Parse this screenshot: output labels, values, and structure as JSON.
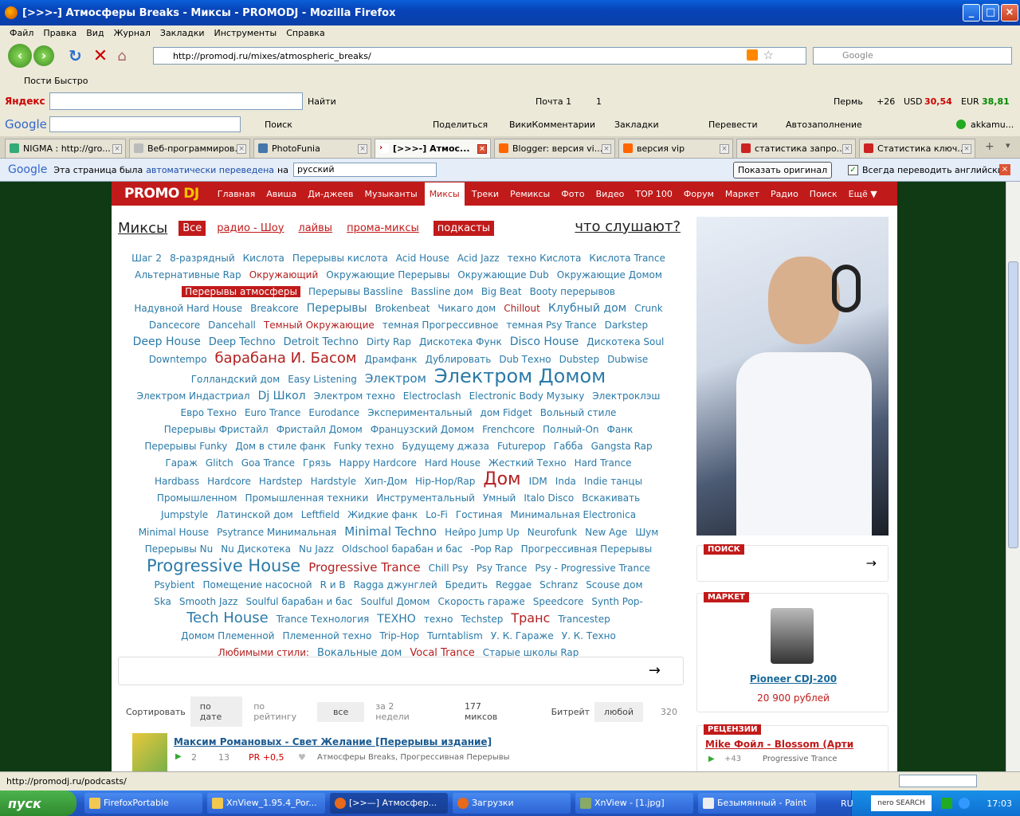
{
  "window": {
    "title": "[>>>-] Атмосферы Breaks - Миксы - PROMODJ - Mozilla Firefox"
  },
  "menu": [
    "Файл",
    "Правка",
    "Вид",
    "Журнал",
    "Закладки",
    "Инструменты",
    "Справка"
  ],
  "nav": {
    "url": "http://promodj.ru/mixes/atmospheric_breaks/",
    "search_placeholder": "Google"
  },
  "bookmarks": {
    "item": "Пости Быстро"
  },
  "yandex": {
    "logo": "Яндекс",
    "find": "Найти",
    "mail": "Почта 1",
    "counter": "1",
    "city": "Пермь",
    "temp": "+26",
    "usd_label": "USD",
    "usd": "30,54",
    "eur_label": "EUR",
    "eur": "38,81"
  },
  "google_toolbar": {
    "logo": "Google",
    "search": "Поиск",
    "share": "Поделиться",
    "wiki": "ВикиКомментарии",
    "bookmarks": "Закладки",
    "translate": "Перевести",
    "autofill": "Автозаполнение",
    "user": "akkamu..."
  },
  "tabs": [
    {
      "label": "NIGMA : http://gro...",
      "color": "#3a7"
    },
    {
      "label": "Веб-программиров...",
      "color": "#999"
    },
    {
      "label": "PhotoFunia",
      "color": "#47a"
    },
    {
      "label": "[>>>-] Атмос...",
      "color": "#d53"
    },
    {
      "label": "Blogger: версия vi...",
      "color": "#f60"
    },
    {
      "label": "версия vip",
      "color": "#f60"
    },
    {
      "label": "статистика запро...",
      "color": "#c22"
    },
    {
      "label": "Статистика ключ...",
      "color": "#c22"
    }
  ],
  "translate_bar": {
    "logo": "Google",
    "text1": "Эта страница была",
    "link": "автоматически переведена",
    "text2": "на",
    "lang": "русский",
    "show_original": "Показать оригинал",
    "always": "Всегда переводить английский"
  },
  "site": {
    "logo1": "PROMO",
    "logo2": "DJ",
    "nav": [
      "Главная",
      "Авиша",
      "Ди-джеев",
      "Музыканты",
      "Миксы",
      "Треки",
      "Ремиксы",
      "Фото",
      "Видео",
      "TOP 100",
      "Форум",
      "Маркет",
      "Радио",
      "Поиск",
      "Ещё ▼"
    ],
    "mixes_title": "Миксы",
    "filters": {
      "all": "Все",
      "radio": "радио - Шоу",
      "lives": "лайвы",
      "promo": "прома-миксы",
      "podcasts": "подкасты"
    },
    "what_listen": "что слушают?",
    "sort": {
      "label": "Сортировать",
      "by_date": "по дате",
      "by_rating": "по рейтингу",
      "all": "все",
      "period": "за 2 недели",
      "count": "177 миксов",
      "bitrate": "Битрейт",
      "any": "любой",
      "bitrate_val": "320"
    },
    "first_mix": {
      "title": "Максим Романовых - Свет Желание [Перерывы издание]",
      "plays": "2",
      "comments": "13",
      "pr": "PR +0,5",
      "tags": "Атмосферы Breaks, Прогрессивная Перерывы"
    },
    "search_box": {
      "title": "ПОИСК"
    },
    "market": {
      "title": "МАРКЕТ",
      "product": "Pioneer CDJ-200",
      "price": "20 900 рублей"
    },
    "reviews": {
      "title": "РЕЦЕНЗИИ",
      "item": "Mike Фойл - Blossom (Арти",
      "count": "+43",
      "tag": "Progressive Trance"
    }
  },
  "tag_lines": [
    [
      [
        "Шаг 2",
        12,
        0
      ],
      [
        "8-разрядный",
        12,
        0
      ],
      [
        "Кислота",
        12,
        0
      ],
      [
        "Перерывы кислота",
        12,
        0
      ],
      [
        "Acid House",
        12,
        0
      ],
      [
        "Acid Jazz",
        12,
        0
      ],
      [
        "техно Кислота",
        12,
        0
      ],
      [
        "Кислота Trance",
        12,
        0
      ]
    ],
    [
      [
        "Альтернативные Rap",
        12,
        0
      ],
      [
        "Окружающий",
        12,
        1
      ],
      [
        "Окружающие Перерывы",
        12,
        0
      ],
      [
        "Окружающие Dub",
        12,
        0
      ],
      [
        "Окружающие Домом",
        12,
        0
      ]
    ],
    [
      [
        "Перерывы атмосферы",
        12,
        2
      ],
      [
        "Перерывы Bassline",
        12,
        0
      ],
      [
        "Bassline дом",
        12,
        0
      ],
      [
        "Big Beat",
        12,
        0
      ],
      [
        "Booty перерывов",
        12,
        0
      ]
    ],
    [
      [
        "Надувной Hard House",
        12,
        0
      ],
      [
        "Breakcore",
        12,
        0
      ],
      [
        "Перерывы",
        14,
        0
      ],
      [
        "Brokenbeat",
        12,
        0
      ],
      [
        "Чикаго дом",
        12,
        0
      ],
      [
        "Chillout",
        12,
        1
      ],
      [
        "Клубный дом",
        14,
        0
      ],
      [
        "Crunk",
        12,
        0
      ]
    ],
    [
      [
        "Dancecore",
        12,
        0
      ],
      [
        "Dancehall",
        12,
        0
      ],
      [
        "Темный Окружающие",
        12,
        1
      ],
      [
        "темная Прогрессивное",
        12,
        0
      ],
      [
        "темная Psy Trance",
        12,
        0
      ],
      [
        "Darkstep",
        12,
        0
      ]
    ],
    [
      [
        "Deep House",
        14,
        0
      ],
      [
        "Deep Techno",
        13,
        0
      ],
      [
        "Detroit Techno",
        13,
        0
      ],
      [
        "Dirty Rap",
        12,
        0
      ],
      [
        "Дискотека Функ",
        12,
        0
      ],
      [
        "Disco House",
        14,
        0
      ],
      [
        "Дискотека Soul",
        12,
        0
      ]
    ],
    [
      [
        "Downtempo",
        12,
        0
      ],
      [
        "барабана И. Басом",
        18,
        1
      ],
      [
        "Драмфанк",
        12,
        0
      ],
      [
        "Дублировать",
        12,
        0
      ],
      [
        "Dub Техно",
        12,
        0
      ],
      [
        "Dubstep",
        12,
        0
      ],
      [
        "Dubwise",
        12,
        0
      ]
    ],
    [
      [
        "Голландский дом",
        12,
        0
      ],
      [
        "Easy Listening",
        12,
        0
      ],
      [
        "Электром",
        15,
        0
      ],
      [
        "Электром Домом",
        24,
        0
      ]
    ],
    [
      [
        "Электром Индастриал",
        12,
        0
      ],
      [
        "Dj Школ",
        14,
        0
      ],
      [
        "Электром техно",
        12,
        0
      ],
      [
        "Electroclash",
        12,
        0
      ],
      [
        "Electronic Body Музыку",
        12,
        0
      ],
      [
        "Электроклэш",
        12,
        0
      ]
    ],
    [
      [
        "Евро Техно",
        12,
        0
      ],
      [
        "Euro Trance",
        12,
        0
      ],
      [
        "Eurodance",
        12,
        0
      ],
      [
        "Экспериментальный",
        12,
        0
      ],
      [
        "дом Fidget",
        12,
        0
      ],
      [
        "Вольный стиле",
        12,
        0
      ]
    ],
    [
      [
        "Перерывы Фристайл",
        12,
        0
      ],
      [
        "Фристайл Домом",
        12,
        0
      ],
      [
        "Французский Домом",
        12,
        0
      ],
      [
        "Frenchcore",
        12,
        0
      ],
      [
        "Полный-On",
        12,
        0
      ],
      [
        "Фанк",
        12,
        0
      ]
    ],
    [
      [
        "Перерывы Funky",
        12,
        0
      ],
      [
        "Дом в стиле фанк",
        12,
        0
      ],
      [
        "Funky техно",
        12,
        0
      ],
      [
        "Будущему джаза",
        12,
        0
      ],
      [
        "Futurepop",
        12,
        0
      ],
      [
        "Габба",
        12,
        0
      ],
      [
        "Gangsta Rap",
        12,
        0
      ]
    ],
    [
      [
        "Гараж",
        12,
        0
      ],
      [
        "Glitch",
        12,
        0
      ],
      [
        "Goa Trance",
        12,
        0
      ],
      [
        "Грязь",
        12,
        0
      ],
      [
        "Happy Hardcore",
        12,
        0
      ],
      [
        "Hard House",
        12,
        0
      ],
      [
        "Жесткий Техно",
        12,
        0
      ],
      [
        "Hard Trance",
        12,
        0
      ]
    ],
    [
      [
        "Hardbass",
        12,
        0
      ],
      [
        "Hardcore",
        12,
        0
      ],
      [
        "Hardstep",
        12,
        0
      ],
      [
        "Hardstyle",
        12,
        0
      ],
      [
        "Хип-Дом",
        12,
        0
      ],
      [
        "Hip-Hop/Rap",
        12,
        0
      ],
      [
        "Дом",
        22,
        1
      ],
      [
        "IDM",
        12,
        0
      ],
      [
        "Inda",
        12,
        0
      ],
      [
        "Indie танцы",
        12,
        0
      ]
    ],
    [
      [
        "Промышленном",
        12,
        0
      ],
      [
        "Промышленная техники",
        12,
        0
      ],
      [
        "Инструментальный",
        12,
        0
      ],
      [
        "Умный",
        12,
        0
      ],
      [
        "Italo Disco",
        12,
        0
      ],
      [
        "Вскакивать",
        12,
        0
      ]
    ],
    [
      [
        "Jumpstyle",
        12,
        0
      ],
      [
        "Латинской дом",
        12,
        0
      ],
      [
        "Leftfield",
        12,
        0
      ],
      [
        "Жидкие фанк",
        12,
        0
      ],
      [
        "Lo-Fi",
        12,
        0
      ],
      [
        "Гостиная",
        12,
        0
      ],
      [
        "Минимальная Electronica",
        12,
        0
      ]
    ],
    [
      [
        "Minimal House",
        12,
        0
      ],
      [
        "Psytrance Минимальная",
        12,
        0
      ],
      [
        "Minimal Techno",
        15,
        0
      ],
      [
        "Нейро Jump Up",
        12,
        0
      ],
      [
        "Neurofunk",
        12,
        0
      ],
      [
        "New Age",
        12,
        0
      ],
      [
        "Шум",
        12,
        0
      ]
    ],
    [
      [
        "Перерывы Nu",
        12,
        0
      ],
      [
        "Nu Дискотека",
        12,
        0
      ],
      [
        "Nu Jazz",
        12,
        0
      ],
      [
        "Oldschool барабан и бас",
        12,
        0
      ],
      [
        "-Pop Rap",
        12,
        0
      ],
      [
        "Прогрессивная Перерывы",
        12,
        0
      ]
    ],
    [
      [
        "Progressive House",
        21,
        0
      ],
      [
        "Progressive Trance",
        15,
        1
      ],
      [
        "Chill Psy",
        12,
        0
      ],
      [
        "Psy Trance",
        12,
        0
      ],
      [
        "Psy - Progressive Trance",
        12,
        0
      ]
    ],
    [
      [
        "Psybient",
        12,
        0
      ],
      [
        "Помещение насосной",
        12,
        0
      ],
      [
        "R и B",
        12,
        0
      ],
      [
        "Ragga джунглей",
        12,
        0
      ],
      [
        "Бредить",
        12,
        0
      ],
      [
        "Reggae",
        12,
        0
      ],
      [
        "Schranz",
        12,
        0
      ],
      [
        "Scouse дом",
        12,
        0
      ]
    ],
    [
      [
        "Ska",
        12,
        0
      ],
      [
        "Smooth Jazz",
        12,
        0
      ],
      [
        "Soulful барабан и бас",
        12,
        0
      ],
      [
        "Soulful Домом",
        12,
        0
      ],
      [
        "Скорость гараже",
        12,
        0
      ],
      [
        "Speedcore",
        12,
        0
      ],
      [
        "Synth Pop-",
        12,
        0
      ]
    ],
    [
      [
        "Tech House",
        18,
        0
      ],
      [
        "Trance Технология",
        12,
        0
      ],
      [
        "ТЕХНО",
        14,
        0
      ],
      [
        "техно",
        12,
        0
      ],
      [
        "Techstep",
        12,
        0
      ],
      [
        "Транс",
        16,
        1
      ],
      [
        "Trancestep",
        12,
        0
      ]
    ],
    [
      [
        "Домом Племенной",
        12,
        0
      ],
      [
        "Племенной техно",
        12,
        0
      ],
      [
        "Trip-Hop",
        12,
        0
      ],
      [
        "Turntablism",
        12,
        0
      ],
      [
        "У. К. Гараже",
        12,
        0
      ],
      [
        "У. К. Техно",
        12,
        0
      ]
    ],
    [
      [
        "Любимыми стили:",
        12,
        1
      ],
      [
        "Вокальные дом",
        13,
        0
      ],
      [
        "Vocal Trance",
        13,
        1
      ],
      [
        "Старые школы Rap",
        12,
        0
      ]
    ]
  ],
  "status": {
    "text": "http://promodj.ru/podcasts/"
  },
  "taskbar": {
    "start": "пуск",
    "items": [
      {
        "label": "FirefoxPortable",
        "on": false
      },
      {
        "label": "XnView_1.95.4_Por...",
        "on": false
      },
      {
        "label": "[>>—] Атмосфер...",
        "on": true
      },
      {
        "label": "Загрузки",
        "on": false
      },
      {
        "label": "XnView - [1.jpg]",
        "on": false
      },
      {
        "label": "Безымянный - Paint",
        "on": false
      }
    ],
    "lang": "RU",
    "nero": "nero SEARCH",
    "time": "17:03"
  }
}
